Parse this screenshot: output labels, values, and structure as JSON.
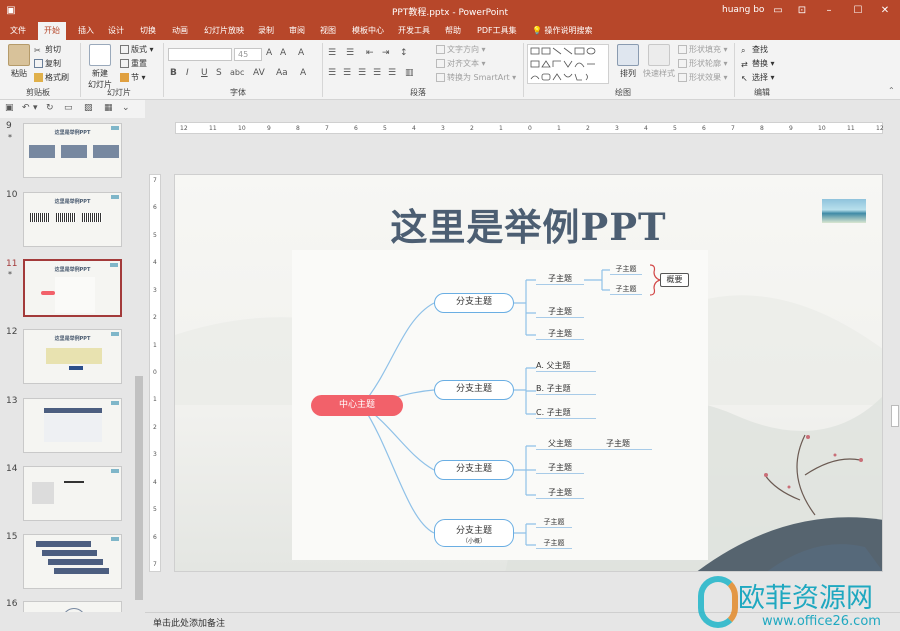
{
  "app": {
    "window_title": "PPT教程.pptx  -  PowerPoint",
    "user": "huang bo",
    "accent": "#b7472a"
  },
  "tabs": [
    "文件",
    "开始",
    "插入",
    "设计",
    "切换",
    "动画",
    "幻灯片放映",
    "录制",
    "审阅",
    "视图",
    "模板中心",
    "开发工具",
    "帮助",
    "PDF工具集"
  ],
  "tell_me": "操作说明搜索",
  "ribbon": {
    "clipboard": {
      "paste": "粘贴",
      "cut": "剪切",
      "copy": "复制",
      "format_painter": "格式刷",
      "label": "剪贴板"
    },
    "slides": {
      "new_slide_line1": "新建",
      "new_slide_line2": "幻灯片",
      "layout": "版式",
      "reset": "重置",
      "section": "节",
      "label": "幻灯片"
    },
    "font": {
      "size": "45",
      "label": "字体"
    },
    "paragraph": {
      "text_direction": "文字方向",
      "align_text": "对齐文本",
      "smartart": "转换为 SmartArt",
      "label": "段落"
    },
    "drawing": {
      "arrange": "排列",
      "quick_styles": "快速样式",
      "shape_fill": "形状填充",
      "shape_outline": "形状轮廓",
      "shape_effects": "形状效果",
      "label": "绘图"
    },
    "editing": {
      "find": "查找",
      "replace": "替换",
      "select": "选择",
      "label": "编辑"
    }
  },
  "thumbnails": [
    {
      "num": "9",
      "title": "这里是举例PPT",
      "star": "*"
    },
    {
      "num": "10",
      "title": "这里是举例PPT",
      "star": ""
    },
    {
      "num": "11",
      "title": "这里是举例PPT",
      "star": "*"
    },
    {
      "num": "12",
      "title": "这里是举例PPT",
      "star": ""
    },
    {
      "num": "13",
      "title": "",
      "star": ""
    },
    {
      "num": "14",
      "title": "",
      "star": ""
    },
    {
      "num": "15",
      "title": "",
      "star": ""
    },
    {
      "num": "16",
      "title": "",
      "star": ""
    }
  ],
  "hruler_labels": [
    "12",
    "11",
    "10",
    "9",
    "8",
    "7",
    "6",
    "5",
    "4",
    "3",
    "2",
    "1",
    "0",
    "1",
    "2",
    "3",
    "4",
    "5",
    "6",
    "7",
    "8",
    "9",
    "10",
    "11",
    "12"
  ],
  "vruler_labels": [
    "7",
    "6",
    "5",
    "4",
    "3",
    "2",
    "1",
    "0",
    "1",
    "2",
    "3",
    "4",
    "5",
    "6",
    "7"
  ],
  "slide": {
    "title": "这里是举例PPT",
    "mindmap": {
      "center": "中心主题",
      "branches": [
        {
          "label": "分支主题",
          "children": [
            "子主题",
            "子主题",
            "子主题"
          ],
          "sub": [
            "子主题",
            "子主题"
          ],
          "summary": "概要"
        },
        {
          "label": "分支主题",
          "children": [
            "A. 父主题",
            "B. 子主题",
            "C. 子主题"
          ]
        },
        {
          "label": "分支主题",
          "children": [
            "父主题",
            "子主题",
            "子主题"
          ],
          "extra": "子主题"
        },
        {
          "label": "分支主题",
          "note": "（小概）",
          "children": [
            "子主题",
            "子主题"
          ]
        }
      ]
    }
  },
  "notes_placeholder": "单击此处添加备注",
  "watermark": {
    "name": "欧菲资源网",
    "url": "www.office26.com"
  }
}
